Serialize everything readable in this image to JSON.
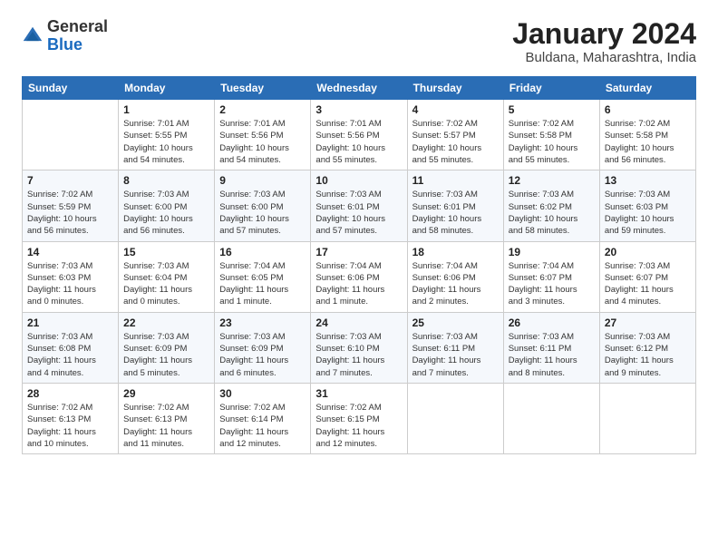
{
  "logo": {
    "general": "General",
    "blue": "Blue"
  },
  "title": "January 2024",
  "location": "Buldana, Maharashtra, India",
  "days_of_week": [
    "Sunday",
    "Monday",
    "Tuesday",
    "Wednesday",
    "Thursday",
    "Friday",
    "Saturday"
  ],
  "weeks": [
    [
      {
        "day": "",
        "info": ""
      },
      {
        "day": "1",
        "info": "Sunrise: 7:01 AM\nSunset: 5:55 PM\nDaylight: 10 hours\nand 54 minutes."
      },
      {
        "day": "2",
        "info": "Sunrise: 7:01 AM\nSunset: 5:56 PM\nDaylight: 10 hours\nand 54 minutes."
      },
      {
        "day": "3",
        "info": "Sunrise: 7:01 AM\nSunset: 5:56 PM\nDaylight: 10 hours\nand 55 minutes."
      },
      {
        "day": "4",
        "info": "Sunrise: 7:02 AM\nSunset: 5:57 PM\nDaylight: 10 hours\nand 55 minutes."
      },
      {
        "day": "5",
        "info": "Sunrise: 7:02 AM\nSunset: 5:58 PM\nDaylight: 10 hours\nand 55 minutes."
      },
      {
        "day": "6",
        "info": "Sunrise: 7:02 AM\nSunset: 5:58 PM\nDaylight: 10 hours\nand 56 minutes."
      }
    ],
    [
      {
        "day": "7",
        "info": "Sunrise: 7:02 AM\nSunset: 5:59 PM\nDaylight: 10 hours\nand 56 minutes."
      },
      {
        "day": "8",
        "info": "Sunrise: 7:03 AM\nSunset: 6:00 PM\nDaylight: 10 hours\nand 56 minutes."
      },
      {
        "day": "9",
        "info": "Sunrise: 7:03 AM\nSunset: 6:00 PM\nDaylight: 10 hours\nand 57 minutes."
      },
      {
        "day": "10",
        "info": "Sunrise: 7:03 AM\nSunset: 6:01 PM\nDaylight: 10 hours\nand 57 minutes."
      },
      {
        "day": "11",
        "info": "Sunrise: 7:03 AM\nSunset: 6:01 PM\nDaylight: 10 hours\nand 58 minutes."
      },
      {
        "day": "12",
        "info": "Sunrise: 7:03 AM\nSunset: 6:02 PM\nDaylight: 10 hours\nand 58 minutes."
      },
      {
        "day": "13",
        "info": "Sunrise: 7:03 AM\nSunset: 6:03 PM\nDaylight: 10 hours\nand 59 minutes."
      }
    ],
    [
      {
        "day": "14",
        "info": "Sunrise: 7:03 AM\nSunset: 6:03 PM\nDaylight: 11 hours\nand 0 minutes."
      },
      {
        "day": "15",
        "info": "Sunrise: 7:03 AM\nSunset: 6:04 PM\nDaylight: 11 hours\nand 0 minutes."
      },
      {
        "day": "16",
        "info": "Sunrise: 7:04 AM\nSunset: 6:05 PM\nDaylight: 11 hours\nand 1 minute."
      },
      {
        "day": "17",
        "info": "Sunrise: 7:04 AM\nSunset: 6:06 PM\nDaylight: 11 hours\nand 1 minute."
      },
      {
        "day": "18",
        "info": "Sunrise: 7:04 AM\nSunset: 6:06 PM\nDaylight: 11 hours\nand 2 minutes."
      },
      {
        "day": "19",
        "info": "Sunrise: 7:04 AM\nSunset: 6:07 PM\nDaylight: 11 hours\nand 3 minutes."
      },
      {
        "day": "20",
        "info": "Sunrise: 7:03 AM\nSunset: 6:07 PM\nDaylight: 11 hours\nand 4 minutes."
      }
    ],
    [
      {
        "day": "21",
        "info": "Sunrise: 7:03 AM\nSunset: 6:08 PM\nDaylight: 11 hours\nand 4 minutes."
      },
      {
        "day": "22",
        "info": "Sunrise: 7:03 AM\nSunset: 6:09 PM\nDaylight: 11 hours\nand 5 minutes."
      },
      {
        "day": "23",
        "info": "Sunrise: 7:03 AM\nSunset: 6:09 PM\nDaylight: 11 hours\nand 6 minutes."
      },
      {
        "day": "24",
        "info": "Sunrise: 7:03 AM\nSunset: 6:10 PM\nDaylight: 11 hours\nand 7 minutes."
      },
      {
        "day": "25",
        "info": "Sunrise: 7:03 AM\nSunset: 6:11 PM\nDaylight: 11 hours\nand 7 minutes."
      },
      {
        "day": "26",
        "info": "Sunrise: 7:03 AM\nSunset: 6:11 PM\nDaylight: 11 hours\nand 8 minutes."
      },
      {
        "day": "27",
        "info": "Sunrise: 7:03 AM\nSunset: 6:12 PM\nDaylight: 11 hours\nand 9 minutes."
      }
    ],
    [
      {
        "day": "28",
        "info": "Sunrise: 7:02 AM\nSunset: 6:13 PM\nDaylight: 11 hours\nand 10 minutes."
      },
      {
        "day": "29",
        "info": "Sunrise: 7:02 AM\nSunset: 6:13 PM\nDaylight: 11 hours\nand 11 minutes."
      },
      {
        "day": "30",
        "info": "Sunrise: 7:02 AM\nSunset: 6:14 PM\nDaylight: 11 hours\nand 12 minutes."
      },
      {
        "day": "31",
        "info": "Sunrise: 7:02 AM\nSunset: 6:15 PM\nDaylight: 11 hours\nand 12 minutes."
      },
      {
        "day": "",
        "info": ""
      },
      {
        "day": "",
        "info": ""
      },
      {
        "day": "",
        "info": ""
      }
    ]
  ]
}
